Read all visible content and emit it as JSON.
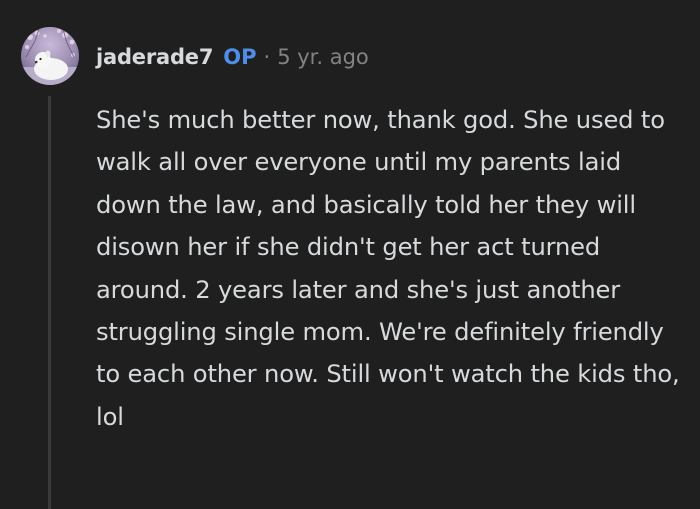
{
  "comment": {
    "username": "jaderade7",
    "badge": "OP",
    "separator": "·",
    "timestamp": "5 yr. ago",
    "avatar_icon": "snoo-avatar-icon",
    "body": "She's much better now, thank god. She used to walk all over everyone until my parents laid down the law, and basically told her they will disown her if she didn't get her act turned around. 2 years later and she's just another struggling single mom. We're definitely friendly to each other now. Still won't watch the kids tho, lol"
  },
  "colors": {
    "background": "#1f1f1f",
    "text": "#d7dadc",
    "muted": "#818384",
    "op_badge": "#4f8ee8",
    "thread_line": "#3a3a3a"
  }
}
